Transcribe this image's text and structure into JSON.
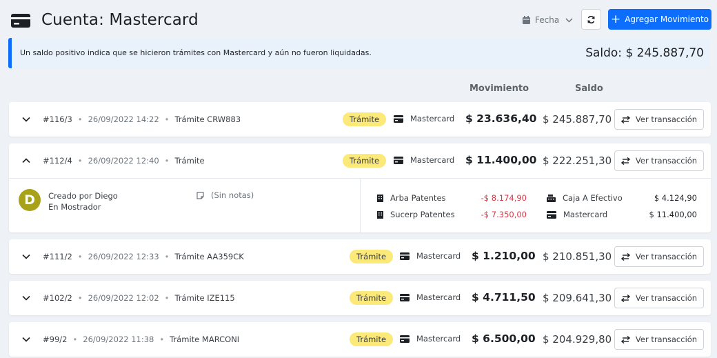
{
  "header": {
    "title": "Cuenta: Mastercard",
    "date_filter_label": "Fecha",
    "add_button_label": "Agregar Movimiento"
  },
  "alert": {
    "message": "Un saldo positivo indica que se hicieron trámites con Mastercard y aún no fueron liquidadas.",
    "balance": "Saldo: $ 245.887,70"
  },
  "columns": {
    "movement": "Movimiento",
    "balance": "Saldo"
  },
  "rows": [
    {
      "id": "#116/3",
      "datetime": "26/09/2022 14:22",
      "description": "Trámite CRW883",
      "badge": "Trámite",
      "account": "Mastercard",
      "amount": "$ 23.636,40",
      "balance": "$ 245.887,70",
      "action": "Ver transacción"
    },
    {
      "id": "#112/4",
      "datetime": "26/09/2022 12:40",
      "description": "Trámite",
      "badge": "Trámite",
      "account": "Mastercard",
      "amount": "$ 11.400,00",
      "balance": "$ 222.251,30",
      "action": "Ver transacción"
    },
    {
      "id": "#111/2",
      "datetime": "26/09/2022 12:33",
      "description": "Trámite AA359CK",
      "badge": "Trámite",
      "account": "Mastercard",
      "amount": "$ 1.210,00",
      "balance": "$ 210.851,30",
      "action": "Ver transacción"
    },
    {
      "id": "#102/2",
      "datetime": "26/09/2022 12:02",
      "description": "Trámite IZE115",
      "badge": "Trámite",
      "account": "Mastercard",
      "amount": "$ 4.711,50",
      "balance": "$ 209.641,30",
      "action": "Ver transacción"
    },
    {
      "id": "#99/2",
      "datetime": "26/09/2022 11:38",
      "description": "Trámite MARCONI",
      "badge": "Trámite",
      "account": "Mastercard",
      "amount": "$ 6.500,00",
      "balance": "$ 204.929,80",
      "action": "Ver transacción"
    }
  ],
  "detail": {
    "avatar_letter": "D",
    "created_by": "Creado por Diego",
    "location": "En Mostrador",
    "notes": "(Sin notas)",
    "debits": [
      {
        "label": "Arba Patentes",
        "value": "-$ 8.174,90",
        "icon": "building-icon"
      },
      {
        "label": "Sucerp Patentes",
        "value": "-$ 7.350,00",
        "icon": "building-icon"
      }
    ],
    "credits": [
      {
        "label": "Caja A Efectivo",
        "value": "$ 4.124,90",
        "icon": "cash-register-icon"
      },
      {
        "label": "Mastercard",
        "value": "$ 11.400,00",
        "icon": "credit-card-icon"
      }
    ]
  },
  "colors": {
    "primary": "#0d6efd",
    "badge": "#fbe97a",
    "negative": "#dc3545",
    "avatar": "#a8a21b"
  }
}
